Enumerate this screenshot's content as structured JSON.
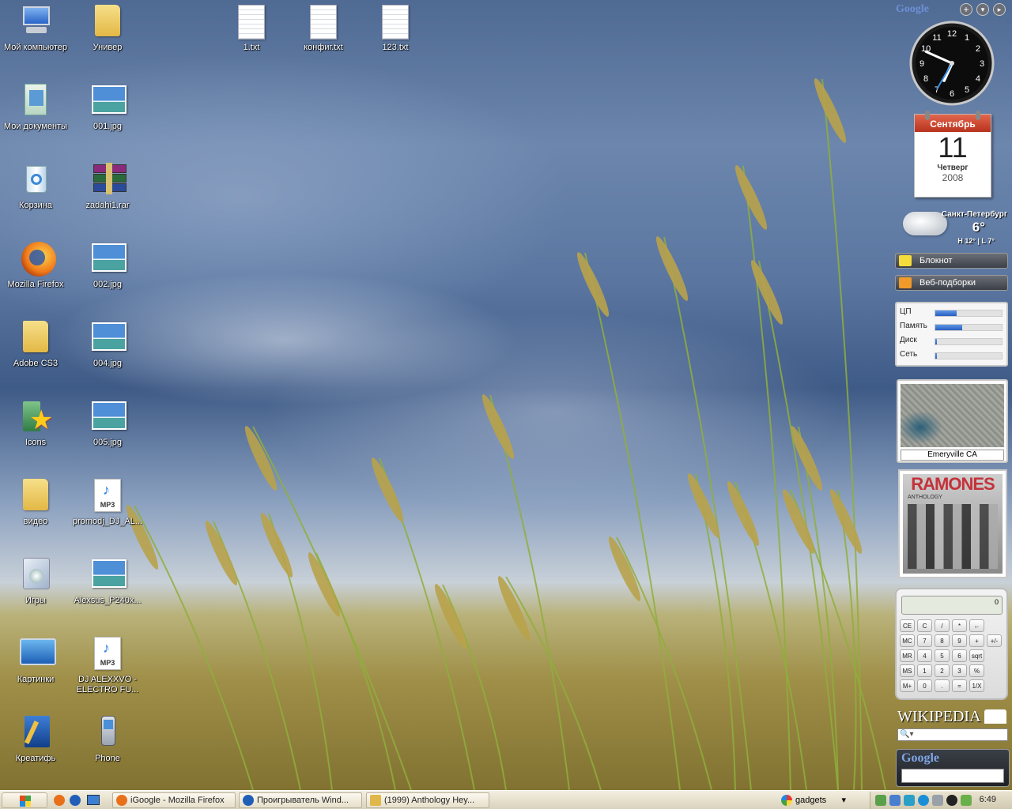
{
  "desktop": {
    "icons": [
      {
        "label": "Мой компьютер",
        "icon": "computer-icon"
      },
      {
        "label": "Мои документы",
        "icon": "documents-icon"
      },
      {
        "label": "Корзина",
        "icon": "recycle-bin-icon"
      },
      {
        "label": "Mozilla Firefox",
        "icon": "firefox-icon"
      },
      {
        "label": "Adobe CS3",
        "icon": "folder-icon"
      },
      {
        "label": "Icons",
        "icon": "star-icon"
      },
      {
        "label": "видео",
        "icon": "folder-icon"
      },
      {
        "label": "Игры",
        "icon": "games-icon"
      },
      {
        "label": "Картинки",
        "icon": "pictures-icon"
      },
      {
        "label": "Креатифь",
        "icon": "creative-icon"
      },
      {
        "label": "Универ",
        "icon": "folder-icon"
      },
      {
        "label": "001.jpg",
        "icon": "image-file-icon"
      },
      {
        "label": "zadahi1.rar",
        "icon": "rar-archive-icon"
      },
      {
        "label": "002.jpg",
        "icon": "image-file-icon"
      },
      {
        "label": "004.jpg",
        "icon": "image-file-icon"
      },
      {
        "label": "005.jpg",
        "icon": "image-file-icon"
      },
      {
        "label": "promodj_DJ_AL...",
        "icon": "mp3-file-icon"
      },
      {
        "label": "Alexsus_P240x...",
        "icon": "image-file-icon"
      },
      {
        "label": "DJ ALEXXVO - ELECTRO FU...",
        "icon": "mp3-file-icon"
      },
      {
        "label": "Phone",
        "icon": "phone-icon"
      },
      {
        "label": "1.txt",
        "icon": "text-file-icon"
      },
      {
        "label": "конфиг.txt",
        "icon": "text-file-icon"
      },
      {
        "label": "123.txt",
        "icon": "text-file-icon"
      }
    ]
  },
  "sidebar": {
    "google_logo": "Google",
    "clock": {
      "hour": 6,
      "minute": 49,
      "second": 35,
      "numerals": [
        "12",
        "1",
        "2",
        "3",
        "4",
        "5",
        "6",
        "7",
        "8",
        "9",
        "10",
        "11"
      ]
    },
    "calendar": {
      "month": "Сентябрь",
      "day": "11",
      "weekday": "Четверг",
      "year": "2008"
    },
    "weather": {
      "city": "Санкт-Петербург",
      "temp": "6°",
      "hi_lo": "H 12° | L 7°"
    },
    "notepad_label": "Блокнот",
    "feeds_label": "Веб-подборки",
    "meter": {
      "rows": [
        {
          "label": "ЦП",
          "level": 0.32
        },
        {
          "label": "Память",
          "level": 0.41
        },
        {
          "label": "Диск",
          "level": 0.01
        },
        {
          "label": "Сеть",
          "level": 0.01
        }
      ]
    },
    "map": {
      "caption": "Emeryville CA"
    },
    "album": {
      "band": "RAMONES",
      "subtitle": "ANTHOLOGY"
    },
    "calculator": {
      "display": "0",
      "keys": [
        [
          "CE",
          "C",
          "/",
          "*",
          "←"
        ],
        [
          "MC",
          "7",
          "8",
          "9",
          "+",
          "+/-"
        ],
        [
          "MR",
          "4",
          "5",
          "6",
          "sqrt"
        ],
        [
          "MS",
          "1",
          "2",
          "3",
          "%"
        ],
        [
          "M+",
          "0",
          ".",
          "=",
          "1/X"
        ]
      ]
    },
    "wikipedia": {
      "title": "WIKIPEDIA"
    },
    "google_search": {
      "logo": "Google",
      "value": ""
    }
  },
  "taskbar": {
    "buttons": [
      {
        "label": "iGoogle - Mozilla Firefox",
        "color": "#e8701a"
      },
      {
        "label": "Проигрыватель Wind...",
        "color": "#1f5fb8"
      },
      {
        "label": "(1999) Anthology Hey...",
        "color": "#e0b84a"
      }
    ],
    "search_label": "gadgets",
    "time": "6:49"
  }
}
